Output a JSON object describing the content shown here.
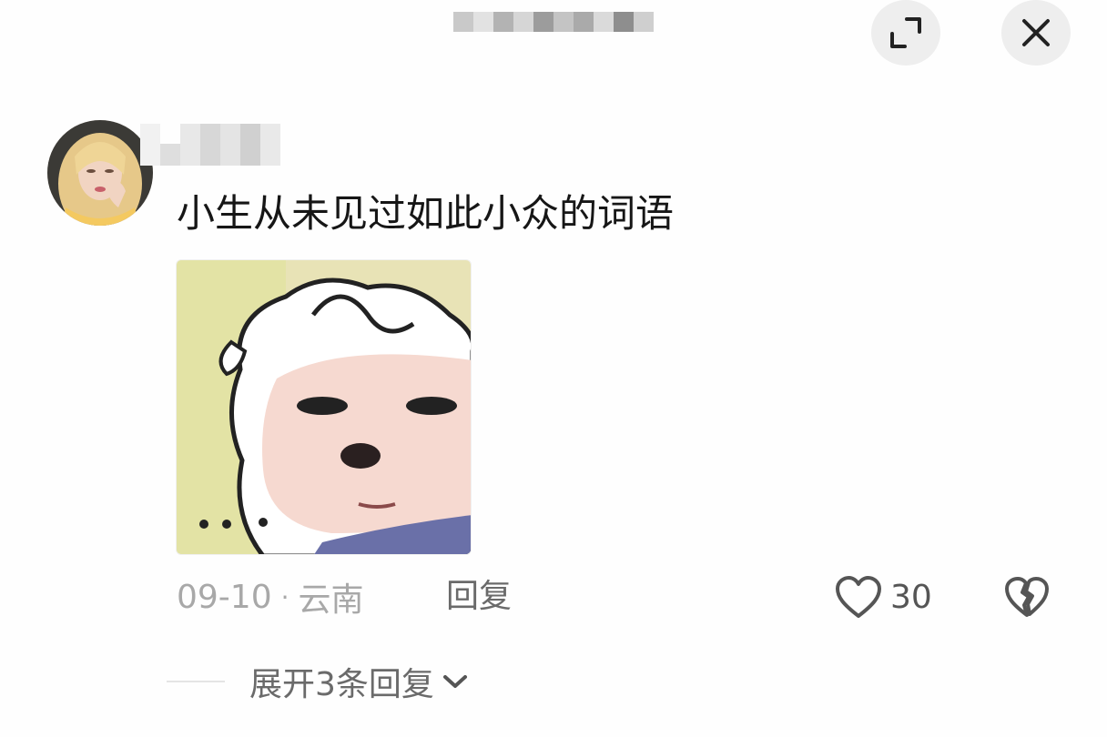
{
  "header": {
    "title_blurred": true,
    "expand_icon": "expand-icon",
    "close_icon": "close-icon"
  },
  "comment": {
    "avatar_icon": "user-avatar",
    "username_blurred": true,
    "text": "小生从未见过如此小众的词语",
    "sticker": "sheep-cartoon-sticker",
    "date": "09-10",
    "separator": "·",
    "location": "云南",
    "reply_label": "回复",
    "like_icon": "heart-outline-icon",
    "like_count": "30",
    "dislike_icon": "broken-heart-icon"
  },
  "replies": {
    "expand_label": "展开3条回复",
    "chevron_icon": "chevron-down-icon"
  },
  "colors": {
    "text_primary": "#161616",
    "text_secondary": "#a8a8a8",
    "text_action": "#6a6a6a",
    "button_bg": "#eeeeee"
  }
}
